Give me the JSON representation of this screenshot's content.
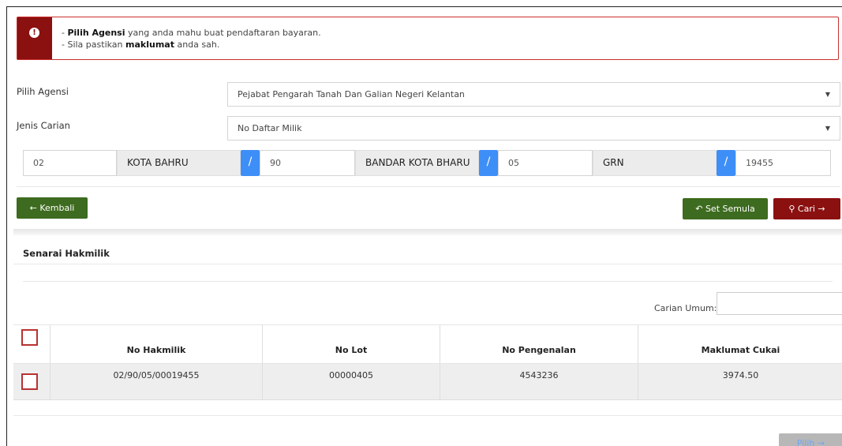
{
  "alert": {
    "line1_bold": "Pilih Agensi",
    "line1_rest": " yang anda mahu buat pendaftaran bayaran.",
    "line2_pre": "- Sila pastikan ",
    "line2_bold": "maklumat",
    "line2_post": " anda sah.",
    "bullet": "- "
  },
  "form": {
    "agency_label": "Pilih Agensi",
    "agency_value": "Pejabat Pengarah Tanah Dan Galian Negeri Kelantan",
    "search_type_label": "Jenis Carian",
    "search_type_value": "No Daftar Milik",
    "title": {
      "state_code": "02",
      "district": "KOTA BAHRU",
      "district_code": "90",
      "mukim": "BANDAR KOTA BHARU",
      "mukim_code": "05",
      "title_type": "GRN",
      "title_no": "19455",
      "separator": "/"
    }
  },
  "buttons": {
    "back": "← Kembali",
    "reset": "Set Semula",
    "search": "Cari →",
    "select": "Pilih →"
  },
  "results": {
    "section_title": "Senarai Hakmilik",
    "search_label": "Carian Umum:",
    "columns": [
      "No Hakmilik",
      "No Lot",
      "No Pengenalan",
      "Maklumat Cukai"
    ],
    "rows": [
      [
        "02/90/05/00019455",
        "00000405",
        "4543236",
        "3974.50"
      ]
    ]
  },
  "colors": {
    "alert_red": "#8b1010",
    "primary_green": "#3d6b1f",
    "accent_blue": "#3e8ef7"
  },
  "icons": {
    "alert": "info-circle-icon",
    "reset": "undo-icon",
    "search": "magnifier-icon"
  }
}
